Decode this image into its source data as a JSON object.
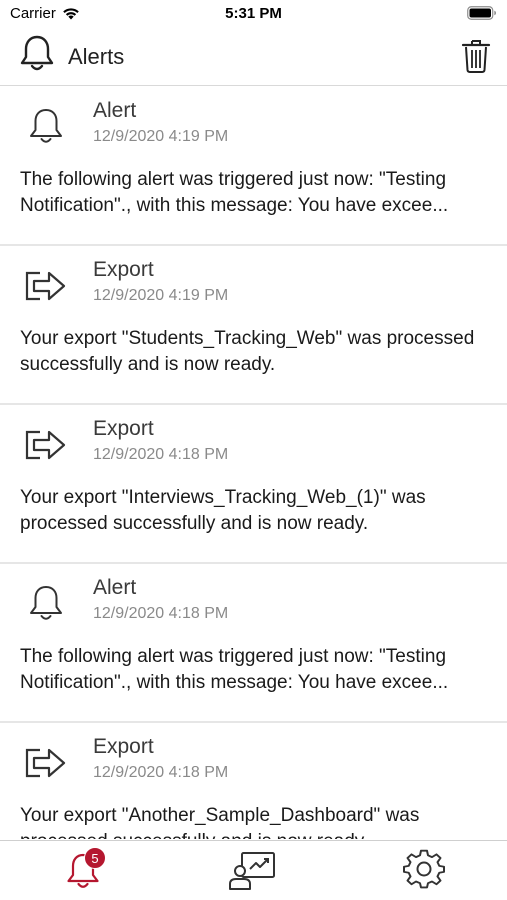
{
  "status_bar": {
    "carrier": "Carrier",
    "time": "5:31 PM"
  },
  "header": {
    "title": "Alerts",
    "icon": "bell-icon",
    "action_icon": "trash-icon"
  },
  "notifications": [
    {
      "type": "Alert",
      "icon": "bell-icon",
      "timestamp": "12/9/2020 4:19 PM",
      "message": "The following alert was triggered just now: \"Testing Notification\"., with this message: You have excee..."
    },
    {
      "type": "Export",
      "icon": "export-icon",
      "timestamp": "12/9/2020 4:19 PM",
      "message": "Your export \"Students_Tracking_Web\" was processed successfully and is now ready."
    },
    {
      "type": "Export",
      "icon": "export-icon",
      "timestamp": "12/9/2020 4:18 PM",
      "message": "Your export \"Interviews_Tracking_Web_(1)\" was processed successfully and is now ready."
    },
    {
      "type": "Alert",
      "icon": "bell-icon",
      "timestamp": "12/9/2020 4:18 PM",
      "message": "The following alert was triggered just now: \"Testing Notification\"., with this message: You have excee..."
    },
    {
      "type": "Export",
      "icon": "export-icon",
      "timestamp": "12/9/2020 4:18 PM",
      "message": "Your export \"Another_Sample_Dashboard\" was processed successfully and is now ready."
    }
  ],
  "tabbar": {
    "alerts": {
      "icon": "bell-icon",
      "badge": "5"
    },
    "dashboards": {
      "icon": "dashboard-icon"
    },
    "settings": {
      "icon": "gear-icon"
    }
  },
  "colors": {
    "accent": "#b5172f",
    "divider": "#e6e6e6",
    "timestamp": "#8a8a8a"
  }
}
